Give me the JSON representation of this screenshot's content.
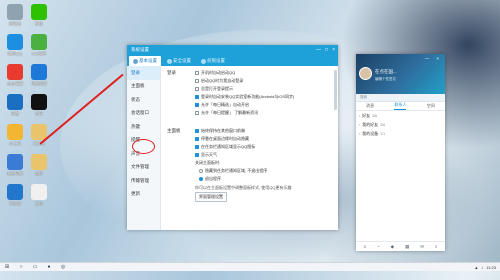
{
  "desktop": {
    "icons": [
      {
        "label": "回收站",
        "color": "#8fa2b0"
      },
      {
        "label": "微信",
        "color": "#2dc100"
      },
      {
        "label": "腾讯QQ",
        "color": "#1c8fe0"
      },
      {
        "label": "360安全",
        "color": "#4ab040"
      },
      {
        "label": "金山毒霸",
        "color": "#e63b2e"
      },
      {
        "label": "电脑管家",
        "color": "#1e78d8"
      },
      {
        "label": "迅雷",
        "color": "#1b6fc2"
      },
      {
        "label": "音乐",
        "color": "#111111"
      },
      {
        "label": "小工具",
        "color": "#f2b632"
      },
      {
        "label": "文件夹",
        "color": "#e9c46a"
      },
      {
        "label": "我的电脑",
        "color": "#3a7bd5"
      },
      {
        "label": "资料",
        "color": "#e9c46a"
      },
      {
        "label": "浏览器",
        "color": "#2277cc"
      },
      {
        "label": "文档",
        "color": "#f0f0f0"
      }
    ]
  },
  "settings_window": {
    "title": "系统设置",
    "controls": [
      "—",
      "□",
      "×"
    ],
    "tabs": [
      {
        "label": "基本设置",
        "active": true
      },
      {
        "label": "安全设置",
        "active": false
      },
      {
        "label": "权限设置",
        "active": false
      }
    ],
    "nav": [
      {
        "label": "登录",
        "active": true
      },
      {
        "label": "主面板",
        "active": false
      },
      {
        "label": "状态",
        "active": false
      },
      {
        "label": "会话窗口",
        "active": false
      },
      {
        "label": "热键",
        "active": false
      },
      {
        "label": "提醒",
        "active": false
      },
      {
        "label": "声音",
        "active": false
      },
      {
        "label": "文件管理",
        "active": false
      },
      {
        "label": "传输管理",
        "active": false
      },
      {
        "label": "更新",
        "active": false
      }
    ],
    "login_section": {
      "title": "登录",
      "options": [
        {
          "text": "开机时自动启动QQ",
          "checked": false
        },
        {
          "text": "启动QQ时为我自动登录",
          "checked": false
        },
        {
          "text": "总是打开登录提示",
          "checked": false
        },
        {
          "text": "登录时自动安装QQ实验室新功能(Android与iOS同步)",
          "checked": true
        },
        {
          "text": "允许「每日精选」自动开启",
          "checked": true
        },
        {
          "text": "允许「每日提醒」 了解最新资讯",
          "checked": false
        }
      ]
    },
    "panel_section": {
      "title": "主面板",
      "options": [
        {
          "text": "始终保持在其他窗口前端",
          "checked": true
        },
        {
          "text": "停靠在桌面边缘时自动隐藏",
          "checked": true
        },
        {
          "text": "在任务栏通知区域显示QQ图标",
          "checked": true
        },
        {
          "text": "显示天气",
          "checked": true
        }
      ],
      "close_label": "关闭主面板时:",
      "radios": [
        {
          "text": "隐藏到任务栏通知区域, 不退出程序",
          "checked": false
        },
        {
          "text": "退出程序",
          "checked": true
        }
      ],
      "note": "你可以在主面板设置中调整面板样式, 使用QQ更有乐趣",
      "button": "界面管理设置"
    }
  },
  "qq_panel": {
    "name": "在点在国...",
    "signature": "编辑个性签名",
    "controls": "— ×",
    "search_placeholder": "搜索",
    "tabs": [
      "消息",
      "联系人",
      "空间"
    ],
    "active_tab": 1,
    "groups": [
      {
        "name": "好友",
        "count": "3/6"
      },
      {
        "name": "我的好友",
        "count": "3/6"
      },
      {
        "name": "我的设备",
        "count": "1/1"
      }
    ],
    "bottom_icons": [
      "menu-icon",
      "chat-icon",
      "game-icon",
      "app-icon"
    ]
  },
  "taskbar": {
    "items": [
      "start-icon",
      "search-icon",
      "folder-icon",
      "qq-icon",
      "browser-icon"
    ],
    "clock": "11:23"
  }
}
